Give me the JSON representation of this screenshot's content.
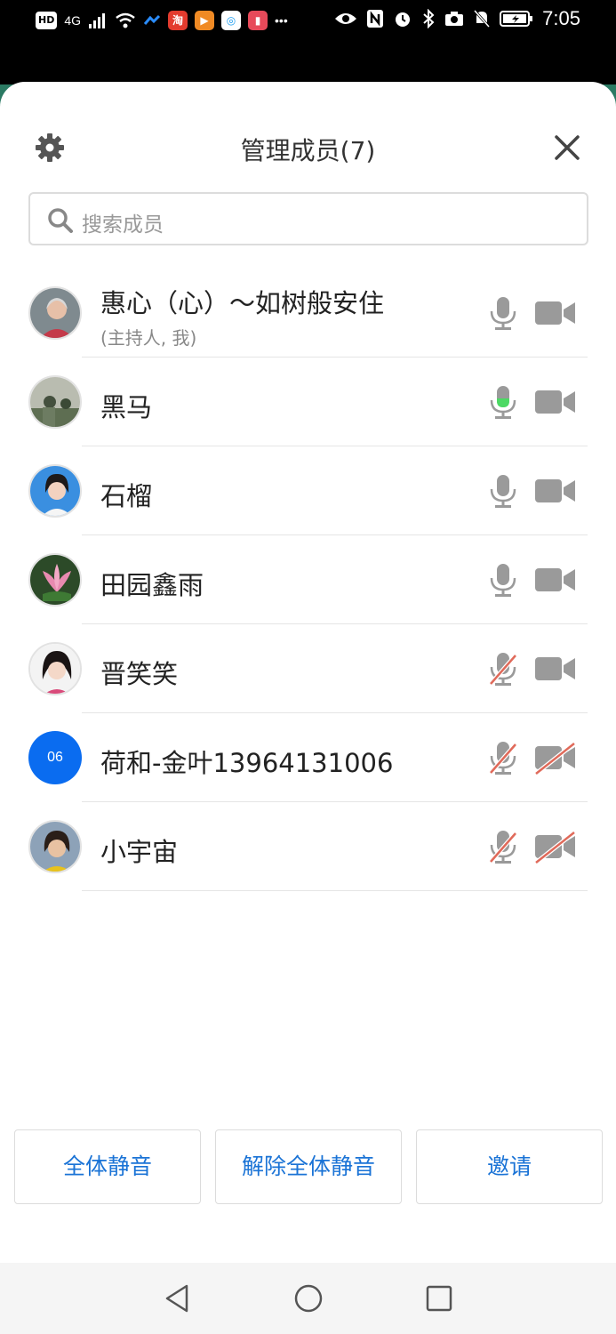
{
  "status_bar": {
    "left_indicators": [
      "HD",
      "4G"
    ],
    "apps": [
      "淘"
    ],
    "time": "7:05"
  },
  "header": {
    "title": "管理成员(7)",
    "settings_icon": "gear-icon",
    "close_icon": "close-icon"
  },
  "search": {
    "placeholder": "搜索成员"
  },
  "members": [
    {
      "name": "惠心（心）～如树般安住",
      "sub": "(主持人, 我)",
      "avatar": "photo",
      "mic": "on",
      "cam": "on"
    },
    {
      "name": "黑马",
      "sub": "",
      "avatar": "photo",
      "mic": "speaking",
      "cam": "on"
    },
    {
      "name": "石榴",
      "sub": "",
      "avatar": "photo",
      "mic": "on",
      "cam": "on"
    },
    {
      "name": "田园鑫雨",
      "sub": "",
      "avatar": "photo",
      "mic": "on",
      "cam": "on"
    },
    {
      "name": "晋笑笑",
      "sub": "",
      "avatar": "photo",
      "mic": "muted",
      "cam": "on"
    },
    {
      "name": "荷和-金叶13964131006",
      "sub": "",
      "avatar_text": "06",
      "mic": "muted",
      "cam": "off"
    },
    {
      "name": "小宇宙",
      "sub": "",
      "avatar": "photo",
      "mic": "muted",
      "cam": "off"
    }
  ],
  "buttons": {
    "mute_all": "全体静音",
    "unmute_all": "解除全体静音",
    "invite": "邀请"
  },
  "colors": {
    "accent": "#1a73d6",
    "mic_speaking": "#4cd964",
    "muted_slash": "#e06a5a",
    "icon_gray": "#999999"
  }
}
